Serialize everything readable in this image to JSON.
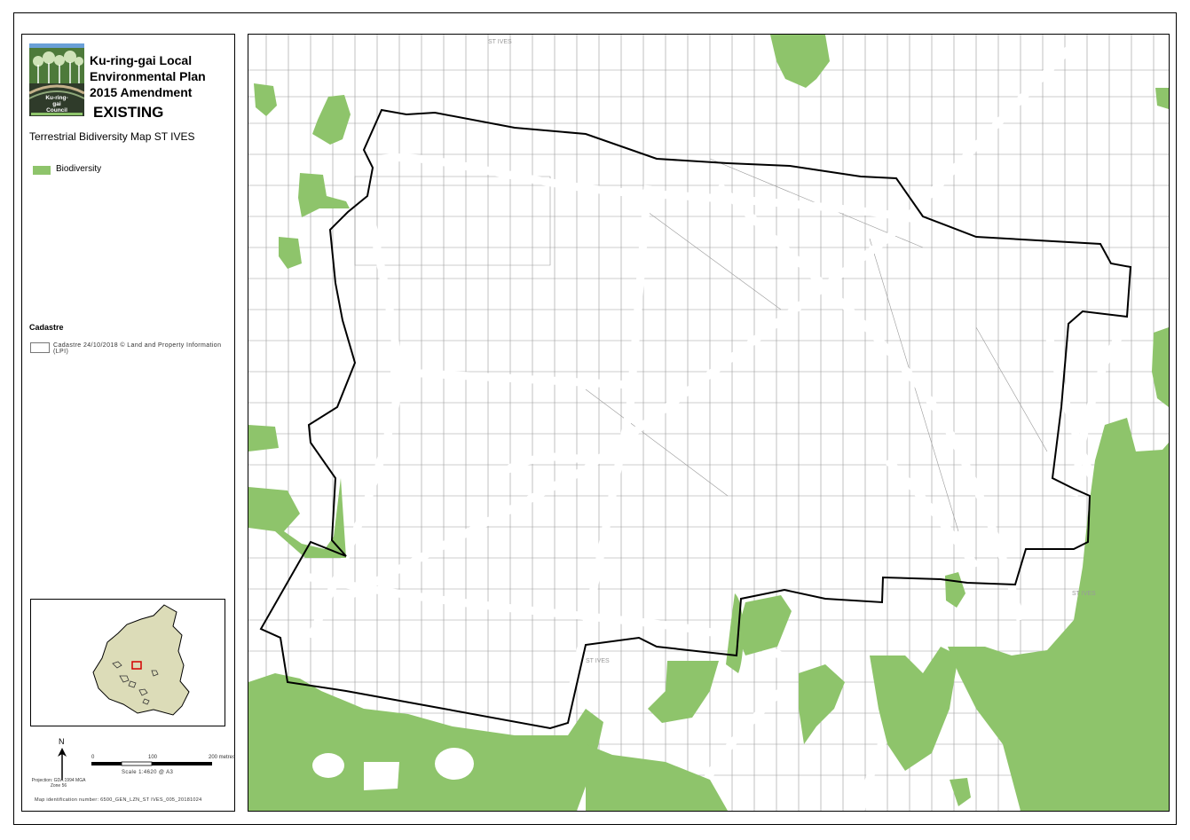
{
  "legend": {
    "council_name_logo": "Ku-ring-gai Council",
    "plan_title": "Ku-ring-gai Local\nEnvironmental Plan\n2015 Amendment",
    "status": "EXISTING",
    "map_title": "Terrestrial Bidiversity Map ST IVES",
    "biodiversity_label": "Biodiversity",
    "cadastre_heading": "Cadastre",
    "cadastre_label": "Cadastre 24/10/2018 © Land and Property Information (LPI)",
    "north_label": "N",
    "scale": {
      "ticks": [
        "0",
        "100",
        "200 metres"
      ],
      "scale_text": "Scale  1:4620   @ A3"
    },
    "projection_text": "Projection: GDA 1994 MGA Zone 56",
    "map_identification": "Map identification number:  6500_GEN_LZN_ST IVES_005_20181024"
  },
  "map": {
    "street_labels": [
      "ST IVES",
      "ST IVES",
      "ST IVES"
    ],
    "colors": {
      "biodiversity": "#8ec46b",
      "cadastre_line": "#9a9a9a",
      "boundary": "#000000",
      "inset_land": "#dcdcb8",
      "inset_highlight": "#d40000"
    }
  }
}
